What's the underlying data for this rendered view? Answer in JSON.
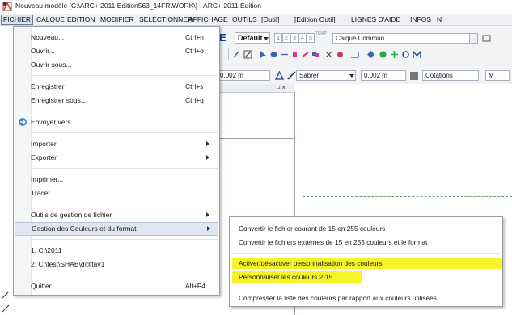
{
  "window": {
    "title": "Nouveau modèle [C:\\ARC+ 2011 Edition563_14FR\\WORK\\] - ARC+ 2011 Edition",
    "app_icon": "arc-app-icon"
  },
  "menubar": {
    "items": [
      {
        "label": "FICHIER",
        "active": true
      },
      {
        "label": "CALQUE"
      },
      {
        "label": "EDITION"
      },
      {
        "label": "MODIFIER"
      },
      {
        "label": "SELECTIONNER"
      },
      {
        "label": "AFFICHAGE"
      },
      {
        "label": "OUTILS"
      },
      {
        "label": "[Outil]"
      },
      {
        "label": "[Edition Outil]"
      },
      {
        "label": "LIGNES D'AIDE"
      },
      {
        "label": "INFOS"
      },
      {
        "label": "N"
      }
    ]
  },
  "toolbar": {
    "e_button": "E",
    "style_select": "Default",
    "layer_numbers": [
      "1",
      "2",
      "3",
      "4",
      "5"
    ],
    "layer_extra": "TEMP",
    "layer_select": "Calque Commun",
    "row3": {
      "value1": "0.002 m",
      "sabrer_select": "Sabrer",
      "value2": "0.002 m",
      "cotations_select": "Cotations",
      "last": "M"
    },
    "panel_controls": "⌑ ×"
  },
  "file_menu": {
    "items": [
      {
        "label": "Nouveau...",
        "shortcut": "Ctrl+n"
      },
      {
        "label": "Ouvrir...",
        "shortcut": "Ctrl+o"
      },
      {
        "label": "Ouvrir sous..."
      },
      {
        "label": "Enregistrer",
        "shortcut": "Ctrl+s"
      },
      {
        "label": "Enregistrer sous...",
        "shortcut": "Ctrl+q"
      },
      {
        "label": "Envoyer vers...",
        "icon": "send-icon"
      },
      {
        "label": "Importer",
        "submenu": true
      },
      {
        "label": "Exporter",
        "submenu": true
      },
      {
        "label": "Imprimer..."
      },
      {
        "label": "Tracer..."
      },
      {
        "label": "Outils de gestion de fichier",
        "submenu": true
      },
      {
        "label": "Gestion des Couleurs et du format",
        "submenu": true,
        "hover": true
      },
      {
        "label": "1. C:\\2011"
      },
      {
        "label": "2. C:\\test\\SHAB\\d@tav1"
      },
      {
        "label": "Quitter",
        "shortcut": "Alt+F4"
      }
    ]
  },
  "color_submenu": {
    "items": [
      {
        "label": "Convertir le fichier courant de 15 en 255 couleurs"
      },
      {
        "label": "Convertir le fichiers externes de 15 en 255 couleurs et le format"
      },
      {
        "label": "Activer/désactiver personnalisation des couleurs",
        "highlight": true
      },
      {
        "label": "Personnaliser les couleurs 2-15",
        "highlight": true
      },
      {
        "label": "Compresser la liste des couleurs par rapport aux couleurs utilisées"
      }
    ],
    "highlight_color": "#f4f428"
  },
  "colors": {
    "menu_hover": "#dfe6f1",
    "guide_line": "#6a9a6a",
    "accent_blue": "#1d3f8f"
  }
}
